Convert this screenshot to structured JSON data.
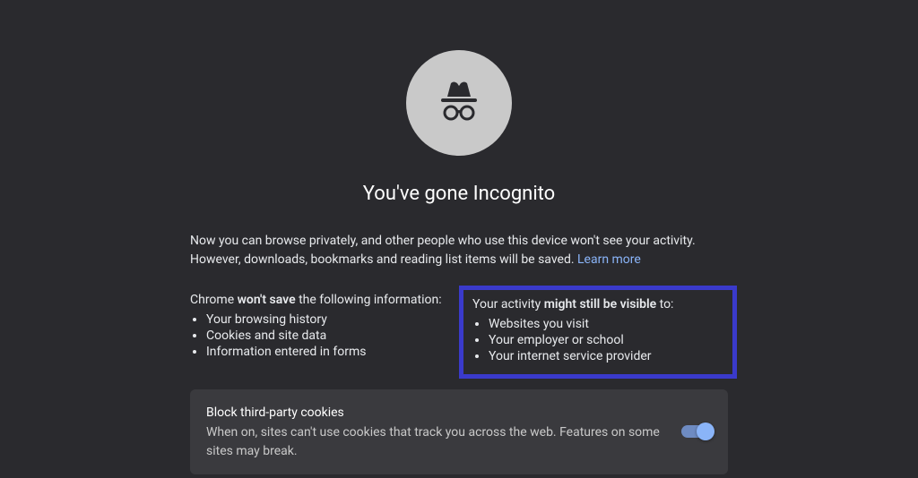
{
  "title": "You've gone Incognito",
  "intro_prefix": "Now you can browse privately, and other people who use this device won't see your activity. However, downloads, bookmarks and reading list items will be saved. ",
  "learn_more": "Learn more",
  "left": {
    "prefix": "Chrome ",
    "strong": "won't save",
    "suffix": " the following information:",
    "items": [
      "Your browsing history",
      "Cookies and site data",
      "Information entered in forms"
    ]
  },
  "right": {
    "prefix": "Your activity ",
    "strong": "might still be visible",
    "suffix": " to:",
    "items": [
      "Websites you visit",
      "Your employer or school",
      "Your internet service provider"
    ]
  },
  "card": {
    "title": "Block third-party cookies",
    "desc": "When on, sites can't use cookies that track you across the web. Features on some sites may break."
  }
}
